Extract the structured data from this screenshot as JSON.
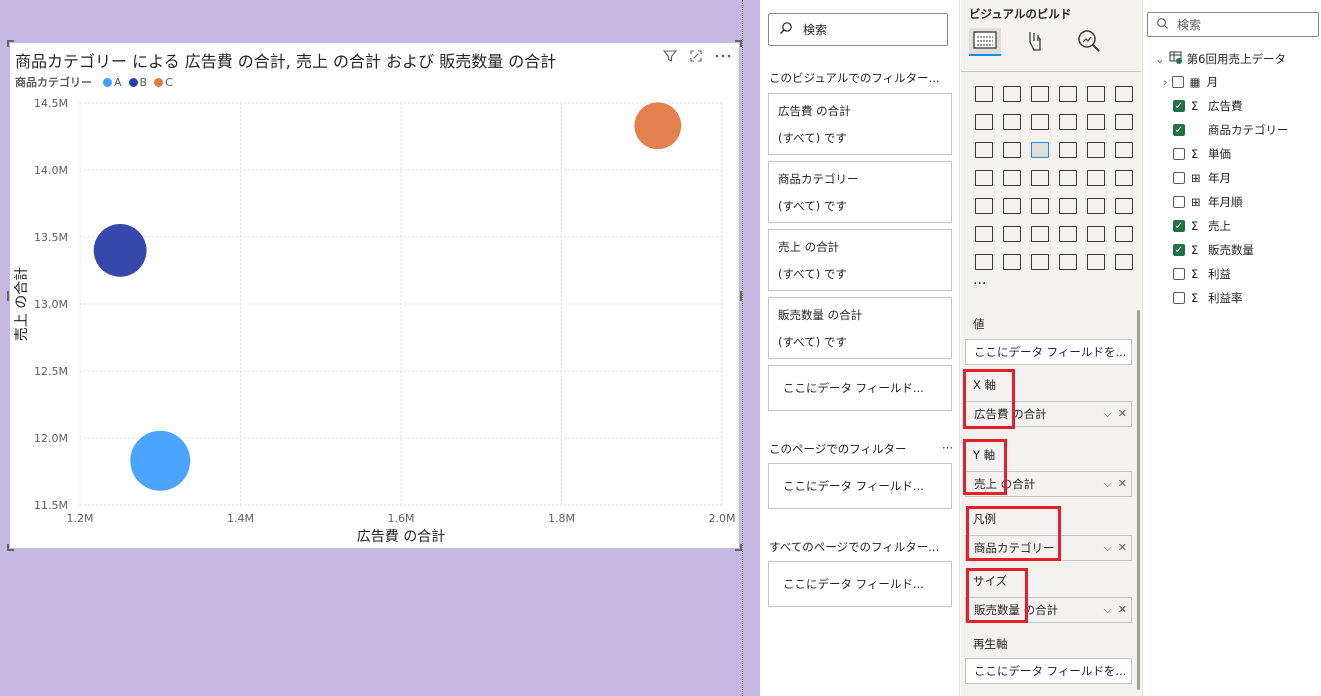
{
  "visual": {
    "title": "商品カテゴリー による 広告費 の合計, 売上 の合計 および 販売数量 の合計",
    "legend_title": "商品カテゴリー",
    "legend": [
      {
        "label": "A",
        "color": "#41a0ff"
      },
      {
        "label": "B",
        "color": "#2b3ea8"
      },
      {
        "label": "C",
        "color": "#e07a45"
      }
    ],
    "icons": [
      "filter-icon",
      "focus-mode-icon",
      "more-options-icon"
    ]
  },
  "chart_data": {
    "type": "scatter",
    "title": "商品カテゴリー による 広告費 の合計, 売上 の合計 および 販売数量 の合計",
    "xlabel": "広告費 の合計",
    "ylabel": "売上 の合計",
    "xlim": [
      1200000,
      2000000
    ],
    "ylim": [
      11500000,
      14500000
    ],
    "xticks": [
      "1.2M",
      "1.4M",
      "1.6M",
      "1.8M",
      "2.0M"
    ],
    "yticks": [
      "11.5M",
      "12.0M",
      "12.5M",
      "13.0M",
      "13.5M",
      "14.0M",
      "14.5M"
    ],
    "grid": true,
    "legend_position": "top-left",
    "series": [
      {
        "name": "A",
        "color": "#41a0ff",
        "points": [
          {
            "x": 1300000,
            "y": 11830000,
            "size": 1.0
          }
        ]
      },
      {
        "name": "B",
        "color": "#2b3ea8",
        "points": [
          {
            "x": 1250000,
            "y": 13400000,
            "size": 0.88
          }
        ]
      },
      {
        "name": "C",
        "color": "#e07a45",
        "points": [
          {
            "x": 1920000,
            "y": 14330000,
            "size": 0.78
          }
        ]
      }
    ]
  },
  "filters": {
    "search_placeholder": "検索",
    "visual_section": "このビジュアルでのフィルター...",
    "cards": [
      {
        "name": "広告費 の合計",
        "value": "(すべて) です"
      },
      {
        "name": "商品カテゴリー",
        "value": "(すべて) です"
      },
      {
        "name": "売上 の合計",
        "value": "(すべて) です"
      },
      {
        "name": "販売数量 の合計",
        "value": "(すべて) です"
      }
    ],
    "drop_visual": "ここにデータ フィールド...",
    "page_section": "このページでのフィルター",
    "page_more": "···",
    "drop_page": "ここにデータ フィールド...",
    "all_section": "すべてのページでのフィルター...",
    "drop_all": "ここにデータ フィールド..."
  },
  "build": {
    "title": "ビジュアルのビルド",
    "more": "···",
    "wells": {
      "values_label": "値",
      "values_placeholder": "ここにデータ フィールドを...",
      "x_label": "X 軸",
      "x_value": "広告費 の合計",
      "y_label": "Y 軸",
      "y_value": "売上 の合計",
      "legend_label": "凡例",
      "legend_value": "商品カテゴリー",
      "size_label": "サイズ",
      "size_value": "販売数量 の合計",
      "play_label": "再生軸",
      "play_placeholder": "ここにデータ フィールドを..."
    }
  },
  "fields": {
    "search_placeholder": "検索",
    "table_name": "第6回用売上データ",
    "items": [
      {
        "label": "月",
        "checked": false,
        "type": "table",
        "expandable": true
      },
      {
        "label": "広告費",
        "checked": true,
        "type": "sigma"
      },
      {
        "label": "商品カテゴリー",
        "checked": true,
        "type": "text"
      },
      {
        "label": "単価",
        "checked": false,
        "type": "sigma"
      },
      {
        "label": "年月",
        "checked": false,
        "type": "calc"
      },
      {
        "label": "年月順",
        "checked": false,
        "type": "calc"
      },
      {
        "label": "売上",
        "checked": true,
        "type": "sigma"
      },
      {
        "label": "販売数量",
        "checked": true,
        "type": "sigma"
      },
      {
        "label": "利益",
        "checked": false,
        "type": "sigma"
      },
      {
        "label": "利益率",
        "checked": false,
        "type": "sigma"
      }
    ]
  }
}
